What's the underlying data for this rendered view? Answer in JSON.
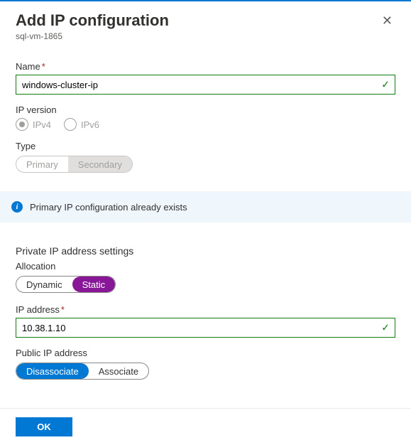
{
  "header": {
    "title": "Add IP configuration",
    "subtitle": "sql-vm-1865"
  },
  "fields": {
    "name": {
      "label": "Name",
      "value": "windows-cluster-ip",
      "required": true,
      "valid": true
    },
    "ipVersion": {
      "label": "IP version",
      "options": [
        "IPv4",
        "IPv6"
      ],
      "selected": "IPv4"
    },
    "type": {
      "label": "Type",
      "options": [
        "Primary",
        "Secondary"
      ],
      "selected": "Secondary"
    }
  },
  "info": {
    "message": "Primary IP configuration already exists"
  },
  "privateIp": {
    "sectionTitle": "Private IP address settings",
    "allocation": {
      "label": "Allocation",
      "options": [
        "Dynamic",
        "Static"
      ],
      "selected": "Static"
    },
    "address": {
      "label": "IP address",
      "value": "10.38.1.10",
      "required": true,
      "valid": true
    }
  },
  "publicIp": {
    "label": "Public IP address",
    "options": [
      "Disassociate",
      "Associate"
    ],
    "selected": "Disassociate"
  },
  "footer": {
    "ok": "OK"
  }
}
